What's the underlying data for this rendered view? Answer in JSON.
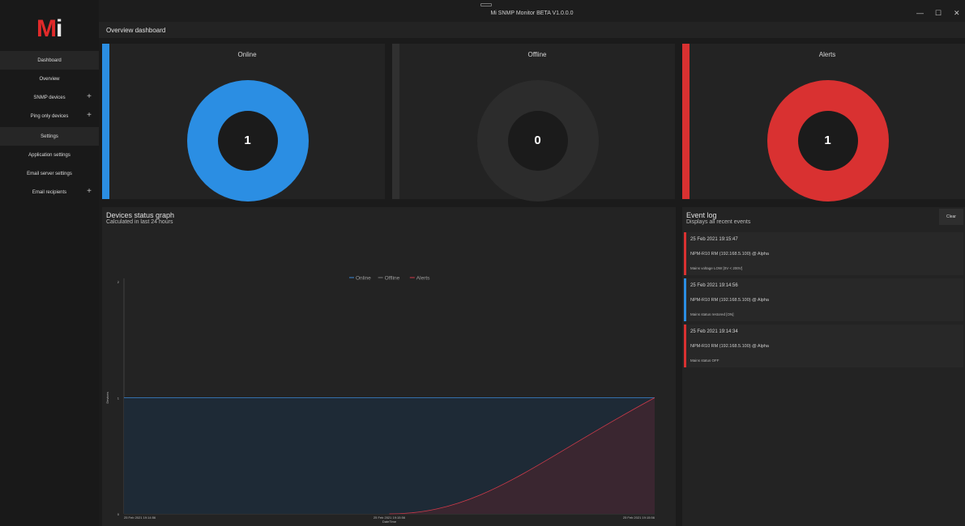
{
  "window": {
    "title": "Mi SNMP Monitor BETA V1.0.0.0",
    "controls": {
      "minimize": "—",
      "maximize": "☐",
      "close": "✕"
    }
  },
  "logo": {
    "m": "M",
    "i": "i"
  },
  "sidebar": {
    "items": [
      {
        "label": "Dashboard",
        "type": "section",
        "plus": ""
      },
      {
        "label": "Overview",
        "type": "item",
        "plus": ""
      },
      {
        "label": "SNMP devices",
        "type": "item",
        "plus": "+"
      },
      {
        "label": "Ping only devices",
        "type": "item",
        "plus": "+"
      },
      {
        "label": "Settings",
        "type": "section",
        "plus": ""
      },
      {
        "label": "Application settings",
        "type": "item",
        "plus": ""
      },
      {
        "label": "Email server settings",
        "type": "item",
        "plus": ""
      },
      {
        "label": "Email recipients",
        "type": "item",
        "plus": "+"
      }
    ]
  },
  "header": {
    "title": "Overview dashboard"
  },
  "cards": [
    {
      "label": "Online",
      "value": "1",
      "color": "#2b8ee3",
      "ring": "#2b8ee3"
    },
    {
      "label": "Offline",
      "value": "0",
      "color": "#303030",
      "ring": "#2c2c2c"
    },
    {
      "label": "Alerts",
      "value": "1",
      "color": "#d93131",
      "ring": "#d93131"
    }
  ],
  "graph": {
    "title": "Devices status graph",
    "subtitle": "Calculated in last 24 hours"
  },
  "chart_data": {
    "type": "area",
    "ylabel": "Devices",
    "xlabel": "DateTime",
    "ylim": [
      0,
      2
    ],
    "y_ticks": [
      "0",
      "1",
      "2"
    ],
    "x_ticks": [
      "25 Feb 2021 19:14:56",
      "25 Feb 2021 19:15:56",
      "25 Feb 2021 19:15:56"
    ],
    "legend_position": "top-center",
    "series": [
      {
        "name": "Online",
        "color": "#3c88d6",
        "values": [
          1,
          1,
          1
        ]
      },
      {
        "name": "Offline",
        "color": "#7a7a7a",
        "values": [
          0,
          0,
          0
        ]
      },
      {
        "name": "Alerts",
        "color": "#cf3a4a",
        "values": [
          0,
          0,
          1
        ]
      }
    ]
  },
  "events": {
    "title": "Event log",
    "subtitle": "Displays all recent events",
    "clear_label": "Clear",
    "items": [
      {
        "timestamp": "25 Feb 2021 19:15:47",
        "device": "NPM-R10 RM (192.168.5.100) @ Alpha",
        "message": "Mains voltage LOW [0V < 200V]",
        "color": "#d93131"
      },
      {
        "timestamp": "25 Feb 2021 19:14:56",
        "device": "NPM-R10 RM (192.168.5.100) @ Alpha",
        "message": "Mains status restored [ON]",
        "color": "#2b8ee3"
      },
      {
        "timestamp": "25 Feb 2021 19:14:34",
        "device": "NPM-R10 RM (192.168.5.100) @ Alpha",
        "message": "Mains status OFF",
        "color": "#d93131"
      }
    ]
  }
}
